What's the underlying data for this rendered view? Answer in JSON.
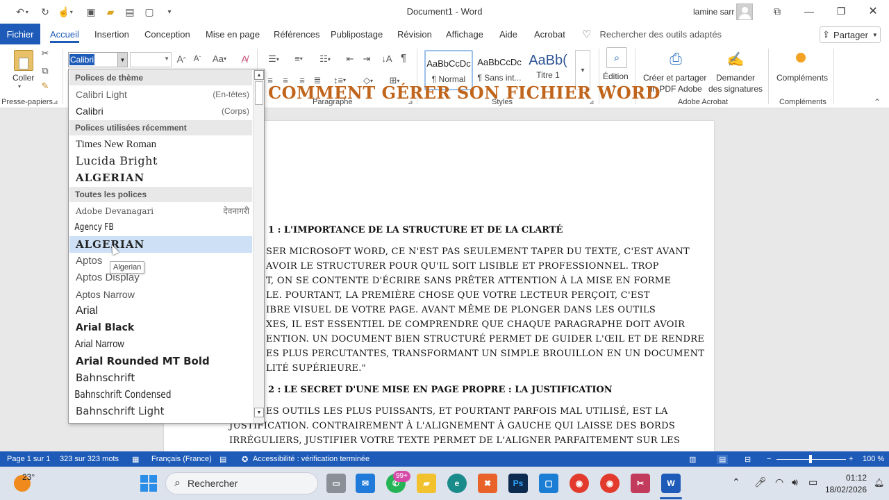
{
  "titlebar": {
    "doc_title": "Document1  -  Word",
    "user_name": "lamine sarr"
  },
  "menu": {
    "file": "Fichier",
    "tabs": [
      "Accueil",
      "Insertion",
      "Conception",
      "Mise en page",
      "Références",
      "Publipostage",
      "Révision",
      "Affichage",
      "Aide",
      "Acrobat"
    ],
    "tell_me": "Rechercher des outils adaptés",
    "share": "Partager"
  },
  "ribbon": {
    "paste_label": "Coller",
    "clipboard_label": "Presse-papiers",
    "font_value": "Calibri",
    "font_size_value": "",
    "paragraph_label": "Paragraphe",
    "styles_label": "Styles",
    "styles": [
      {
        "sample": "AaBbCcDc",
        "name": "¶ Normal"
      },
      {
        "sample": "AaBbCcDc",
        "name": "¶ Sans int..."
      },
      {
        "sample": "AaBb(",
        "name": "Titre 1"
      }
    ],
    "editing_label": "Édition",
    "acrobat_create": [
      "Créer et partager",
      "un PDF Adobe"
    ],
    "acrobat_sign": [
      "Demander",
      "des signatures"
    ],
    "acrobat_label": "Adobe Acrobat",
    "addins": "Compléments",
    "addins_label": "Compléments"
  },
  "font_dropdown": {
    "sections": {
      "theme": "Polices de thème",
      "recent": "Polices utilisées récemment",
      "all": "Toutes les polices"
    },
    "theme_fonts": [
      {
        "name": "Calibri Light",
        "tag": "(En-têtes)"
      },
      {
        "name": "Calibri",
        "tag": "(Corps)"
      }
    ],
    "recent_fonts": [
      "Times New Roman",
      "Lucida Bright",
      "ALGERIAN"
    ],
    "all_fonts": [
      {
        "name": "Adobe Devanagari",
        "tag": "देवनागरी"
      },
      {
        "name": "Agency FB",
        "tag": ""
      },
      {
        "name": "ALGERIAN",
        "tag": ""
      },
      {
        "name": "Aptos",
        "tag": ""
      },
      {
        "name": "Aptos Display",
        "tag": ""
      },
      {
        "name": "Aptos Narrow",
        "tag": ""
      },
      {
        "name": "Arial",
        "tag": ""
      },
      {
        "name": "Arial Black",
        "tag": ""
      },
      {
        "name": "Arial Narrow",
        "tag": ""
      },
      {
        "name": "Arial Rounded MT Bold",
        "tag": ""
      },
      {
        "name": "Bahnschrift",
        "tag": ""
      },
      {
        "name": "Bahnschrift Condensed",
        "tag": ""
      },
      {
        "name": "Bahnschrift Light",
        "tag": ""
      }
    ],
    "hovered": "ALGERIAN",
    "tooltip": "Algerian"
  },
  "document": {
    "title": "COMMENT GÉRER SON FICHIER WORD",
    "heading1": "1 : L'IMPORTANCE DE LA STRUCTURE ET DE LA CLARTÉ",
    "para1": [
      "SER MICROSOFT WORD, CE N'EST PAS SEULEMENT TAPER DU TEXTE, C'EST AVANT",
      "AVOIR LE STRUCTURER POUR QU'IL SOIT LISIBLE ET PROFESSIONNEL. TROP",
      "T, ON SE CONTENTE D'ÉCRIRE SANS PRÊTER ATTENTION À LA MISE EN FORME",
      "LE. POURTANT, LA PREMIÈRE CHOSE QUE VOTRE LECTEUR PERÇOIT, C'EST",
      "IBRE VISUEL DE VOTRE PAGE. AVANT MÊME DE PLONGER DANS LES OUTILS",
      "XES, IL EST ESSENTIEL DE COMPRENDRE QUE CHAQUE PARAGRAPHE DOIT AVOIR",
      "ENTION. UN DOCUMENT BIEN STRUCTURÉ PERMET DE GUIDER L'ŒIL ET DE RENDRE",
      "ES PLUS PERCUTANTES, TRANSFORMANT UN SIMPLE BROUILLON EN UN DOCUMENT",
      "LITÉ SUPÉRIEURE.\""
    ],
    "heading2": "2 : LE SECRET D'UNE MISE EN PAGE PROPRE : LA JUSTIFICATION",
    "para2": [
      "ES OUTILS LES PLUS PUISSANTS, ET POURTANT PARFOIS MAL UTILISÉ, EST LA",
      "JUSTIFICATION. CONTRAIREMENT À L'ALIGNEMENT À GAUCHE QUI LAISSE DES BORDS",
      "IRRÉGULIERS, JUSTIFIER VOTRE TEXTE PERMET DE L'ALIGNER PARFAITEMENT SUR LES"
    ]
  },
  "statusbar": {
    "page": "Page 1 sur 1",
    "words": "323 sur 323 mots",
    "language": "Français (France)",
    "accessibility": "Accessibilité : vérification terminée",
    "zoom": "100 %"
  },
  "taskbar": {
    "weather_temp": "23°",
    "search": "Rechercher",
    "badge": "99+",
    "time": "01:12",
    "date": "18/02/2026"
  },
  "colors": {
    "accent": "#1e5bb8",
    "doc_title": "#c0651b",
    "hover": "#cde0f5"
  }
}
